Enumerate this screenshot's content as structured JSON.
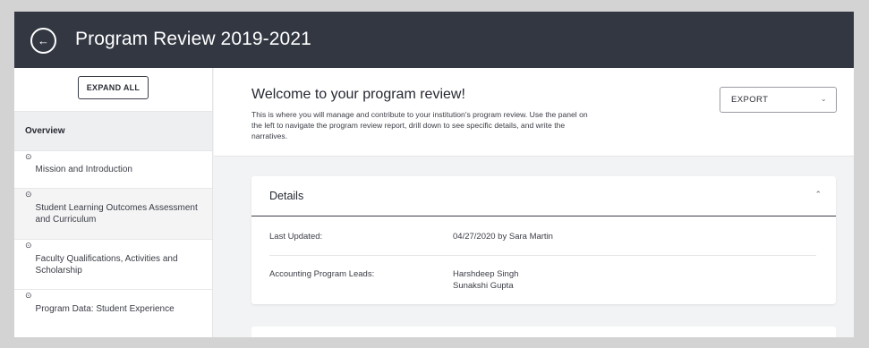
{
  "header": {
    "back_icon": "arrow-left-icon",
    "title": "Program Review 2019-2021"
  },
  "sidebar": {
    "expand_label": "EXPAND ALL",
    "items": [
      {
        "label": "Overview",
        "active": true
      },
      {
        "label": "Mission and Introduction",
        "icon": "circle-dot-icon"
      },
      {
        "label": "Student Learning Outcomes Assessment and Curriculum",
        "icon": "circle-dot-icon"
      },
      {
        "label": "Faculty Qualifications, Activities and Scholarship",
        "icon": "circle-dot-icon"
      },
      {
        "label": "Program Data: Student Experience",
        "icon": "circle-dot-icon"
      }
    ]
  },
  "welcome": {
    "title": "Welcome to your program review!",
    "text": "This is where you will manage and contribute to your institution's program review. Use the panel on the left to navigate the program review report, drill down to see specific details, and write the narratives.",
    "export_label": "EXPORT"
  },
  "details": {
    "title": "Details",
    "rows": [
      {
        "label": "Last Updated:",
        "value": "04/27/2020 by Sara Martin"
      },
      {
        "label": "Accounting Program Leads:",
        "value_lines": [
          "Harshdeep Singh",
          "Sunakshi Gupta"
        ]
      }
    ]
  },
  "colors": {
    "header_bg": "#323742",
    "accent_dark": "#3a3e48",
    "page_bg": "#f2f3f4"
  }
}
